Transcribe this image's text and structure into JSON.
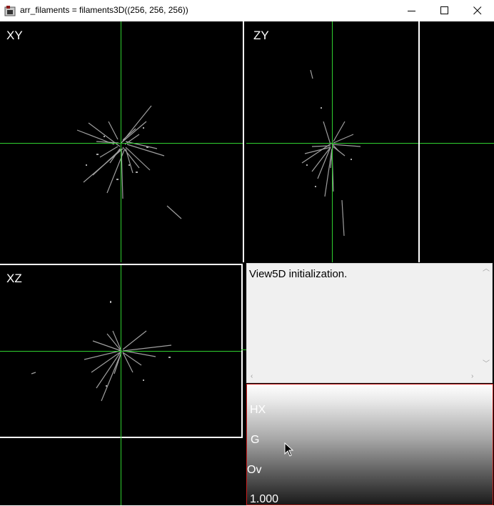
{
  "window": {
    "title": "arr_filaments = filaments3D((256, 256, 256))",
    "app_icon": "imagej-icon",
    "controls": [
      "minimize-icon",
      "maximize-icon",
      "close-icon"
    ]
  },
  "views": {
    "xy": {
      "label": "XY"
    },
    "zy": {
      "label": "ZY"
    },
    "xz": {
      "label": "XZ"
    }
  },
  "message_area": {
    "text": "View5D initialization."
  },
  "colormap_panel": {
    "hx_label": "HX",
    "g_label": "G",
    "ov_label": "Ov",
    "value": "1.000"
  },
  "colors": {
    "crosshair": "#2fd02f",
    "panel_border": "#ffffff",
    "colormap_border": "#c81e1e"
  }
}
